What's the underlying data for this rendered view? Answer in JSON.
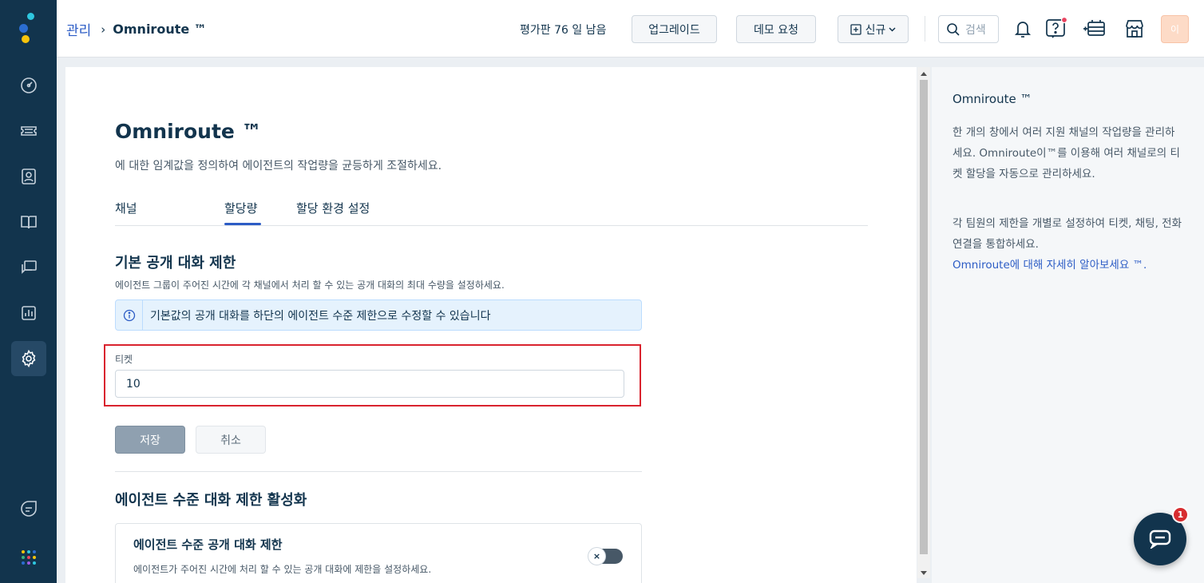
{
  "header": {
    "breadcrumb_parent": "관리",
    "breadcrumb_sep": "›",
    "breadcrumb_current": "Omniroute ™",
    "trial_text": "평가판 76 일 남음",
    "upgrade_label": "업그레이드",
    "demo_label": "데모 요청",
    "new_label": "신규",
    "search_placeholder": "검색",
    "avatar_initial": "이"
  },
  "page": {
    "title": "Omniroute ™",
    "description": "에 대한 임계값을 정의하여 에이전트의 작업량을 균등하게 조절하세요."
  },
  "tabs": [
    {
      "label": "채널"
    },
    {
      "label": "할당량"
    },
    {
      "label": "할당 환경 설정"
    }
  ],
  "default_limit": {
    "title": "기본 공개 대화 제한",
    "description": "에이전트 그룹이 주어진 시간에 각 채널에서 처리 할 수 있는 공개 대화의 최대 수량을 설정하세요.",
    "info_text": "기본값의 공개 대화를 하단의 에이전트 수준 제한으로 수정할 수 있습니다",
    "field_label": "티켓",
    "field_value": "10",
    "save_label": "저장",
    "cancel_label": "취소"
  },
  "agent_limit": {
    "title": "에이전트 수준 대화 제한 활성화",
    "card_title": "에이전트 수준 공개 대화 제한",
    "card_desc": "에이전트가 주어진 시간에 처리 할 수 있는 공개 대화에 제한을 설정하세요.",
    "toggle_symbol": "×"
  },
  "right_panel": {
    "title": "Omniroute ™",
    "para1": "한 개의 창에서 여러 지원 채널의 작업량을 관리하세요. Omniroute이™를 이용해 여러 채널로의 티켓 할당을 자동으로 관리하세요.",
    "para2": "각 팀원의 제한을 개별로 설정하여 티켓, 채팅, 전화 연결을 통합하세요.",
    "link": "Omniroute에 대해 자세히 알아보세요 ™."
  },
  "chat": {
    "badge_count": "1"
  },
  "colors": {
    "sidebar": "#12344d",
    "accent": "#2c5cc5",
    "highlight": "#d9232e"
  }
}
